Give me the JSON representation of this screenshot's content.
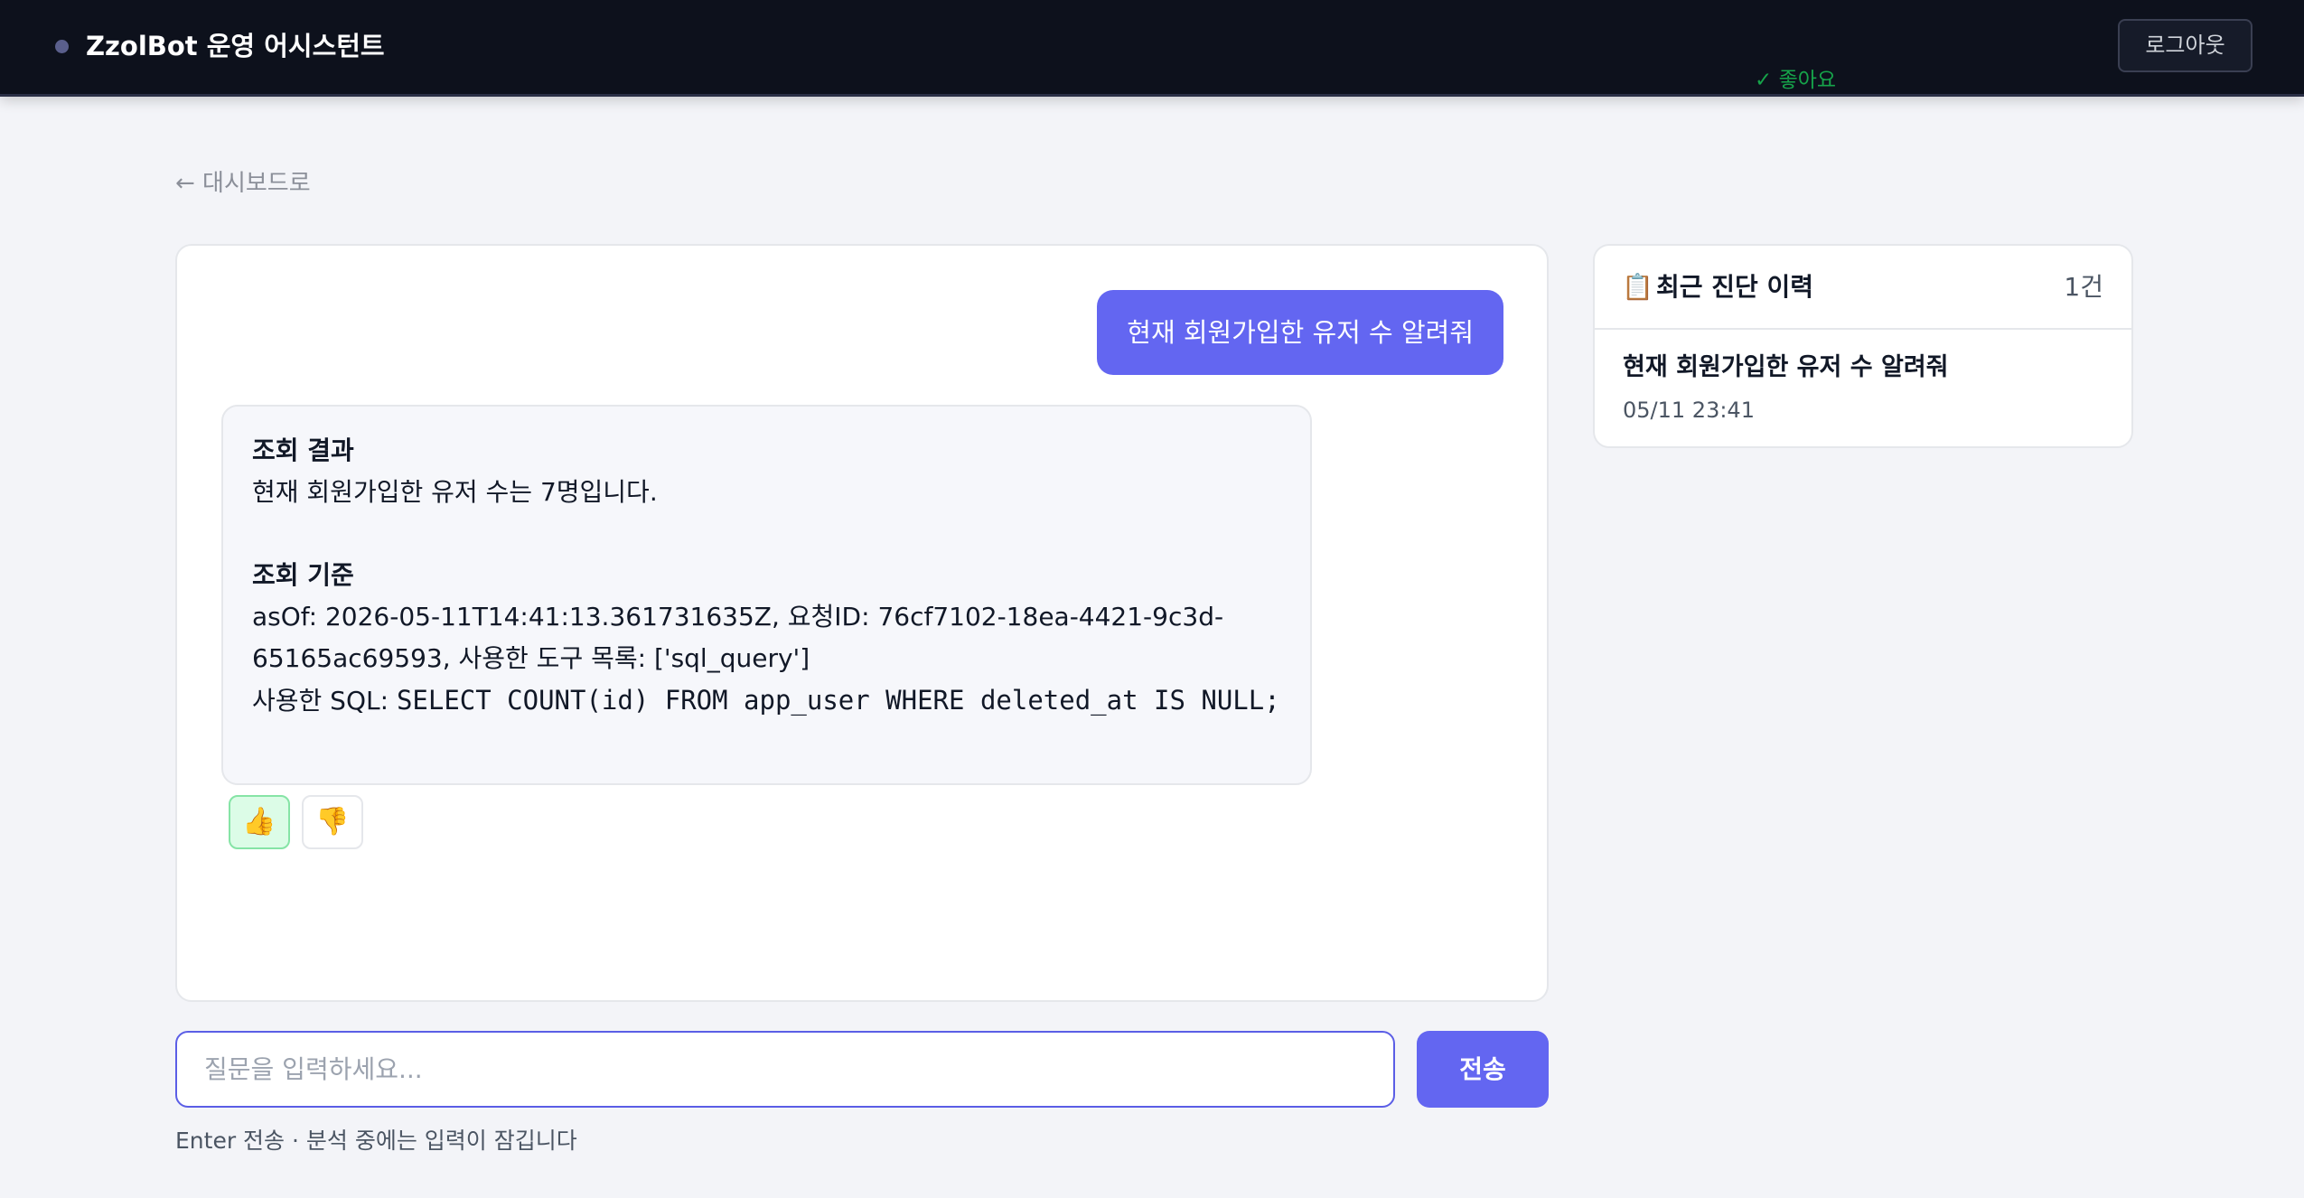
{
  "header": {
    "title": "ZzolBot 운영 어시스턴트",
    "logout_label": "로그아웃"
  },
  "nav": {
    "back_label": "← 대시보드로"
  },
  "chat": {
    "user_message": "현재 회원가입한 유저 수 알려줘",
    "bot_message": {
      "result_heading": "조회 결과",
      "result_text": "현재 회원가입한 유저 수는 7명입니다.",
      "basis_heading": "조회 기준",
      "basis_line1": "asOf: 2026-05-11T14:41:13.361731635Z, 요청ID: 76cf7102-18ea-4421-9c3d-",
      "basis_line2": "65165ac69593, 사용한 도구 목록: ['sql_query']",
      "sql_label": "사용한 SQL: ",
      "sql_query": "SELECT COUNT(id) FROM app_user WHERE deleted_at IS NULL;"
    },
    "feedback": {
      "up_icon": "👍",
      "down_icon": "👎",
      "selected": "up"
    }
  },
  "history": {
    "icon": "📋",
    "title": "최근 진단 이력",
    "count": "1건",
    "items": [
      {
        "title": "현재 회원가입한 유저 수 알려줘",
        "time": "05/11 23:41",
        "status": "✓ 좋아요"
      }
    ]
  },
  "input": {
    "placeholder": "질문을 입력하세요...",
    "value": "",
    "send_label": "전송",
    "hint": "Enter 전송 · 분석 중에는 입력이 잠깁니다"
  },
  "colors": {
    "accent": "#6366f1",
    "header_bg": "#0d111c",
    "page_bg": "#f3f4f8",
    "positive": "#16a34a"
  }
}
